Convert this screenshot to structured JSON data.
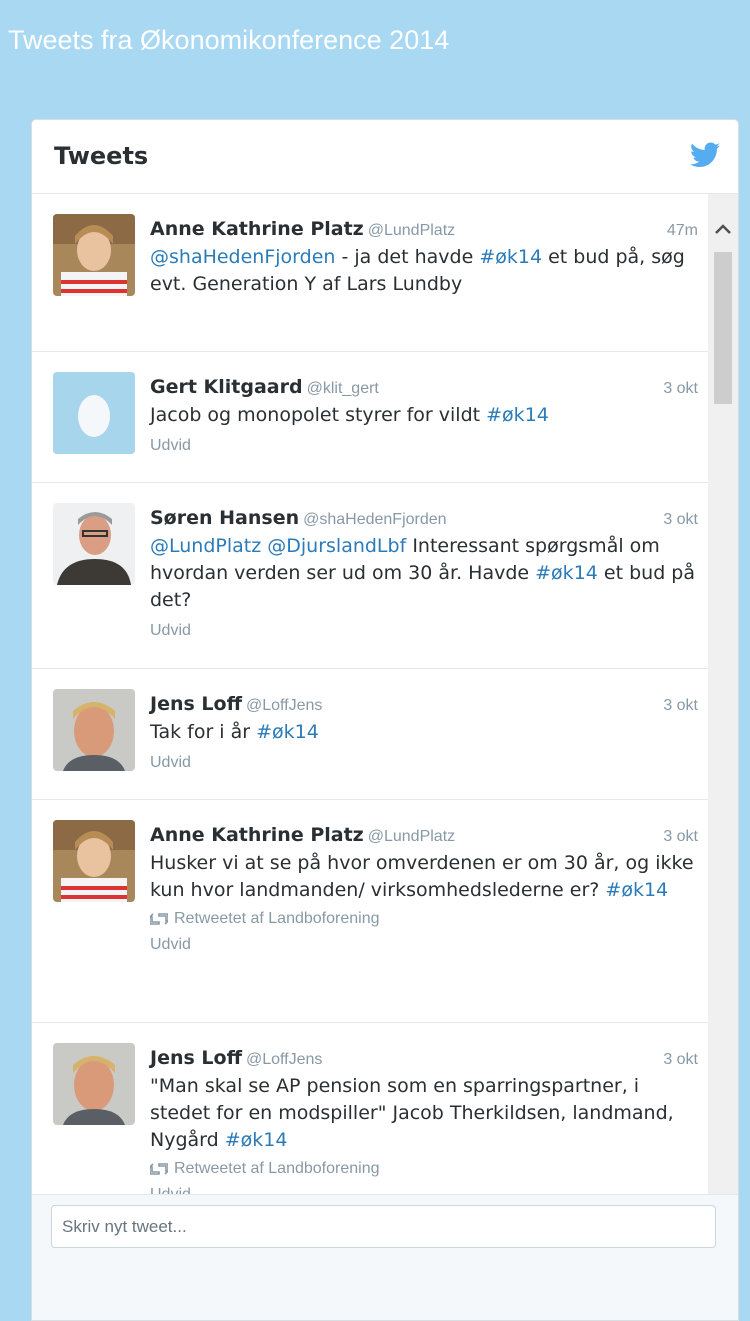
{
  "page": {
    "title": "Tweets fra Økonomikonference 2014"
  },
  "widget": {
    "title": "Tweets",
    "bird_icon": "twitter-bird-icon",
    "bird_color": "#55acee"
  },
  "tweets": [
    {
      "name": "Anne Kathrine Platz",
      "handle": "@LundPlatz",
      "time": "47m",
      "segments": [
        [
          "@shaHedenFjorden",
          true
        ],
        [
          " - ja det havde ",
          false
        ],
        [
          "#øk14",
          true
        ],
        [
          "  et bud på, søg evt. Generation Y af Lars Lundby",
          false
        ]
      ],
      "retweet": "",
      "expand": "",
      "avatar": "woman"
    },
    {
      "name": "Gert Klitgaard",
      "handle": "@klit_gert",
      "time": "3 okt",
      "segments": [
        [
          "Jacob og monopolet styrer for vildt ",
          false
        ],
        [
          "#øk14",
          true
        ]
      ],
      "retweet": "",
      "expand": "Udvid",
      "avatar": "egg"
    },
    {
      "name": "Søren Hansen",
      "handle": "@shaHedenFjorden",
      "time": "3 okt",
      "segments": [
        [
          "@LundPlatz",
          true
        ],
        [
          " ",
          false
        ],
        [
          "@DjurslandLbf",
          true
        ],
        [
          " Interessant spørgsmål om hvordan verden ser ud om 30 år. Havde ",
          false
        ],
        [
          "#øk14",
          true
        ],
        [
          " et bud på det?",
          false
        ]
      ],
      "retweet": "",
      "expand": "Udvid",
      "avatar": "man1"
    },
    {
      "name": "Jens Loff",
      "handle": "@LoffJens",
      "time": "3 okt",
      "segments": [
        [
          "Tak for i år ",
          false
        ],
        [
          "#øk14",
          true
        ]
      ],
      "retweet": "",
      "expand": "Udvid",
      "avatar": "man2"
    },
    {
      "name": "Anne Kathrine Platz",
      "handle": "@LundPlatz",
      "time": "3 okt",
      "segments": [
        [
          "Husker vi at se på hvor omverdenen er om 30 år, og ikke kun hvor landmanden/ virksomhedslederne er? ",
          false
        ],
        [
          "#øk14",
          true
        ]
      ],
      "retweet": "Retweetet af Landboforening",
      "expand": "Udvid",
      "avatar": "woman"
    },
    {
      "name": "Jens Loff",
      "handle": "@LoffJens",
      "time": "3 okt",
      "segments": [
        [
          "\"Man skal se AP pension som en sparringspartner, i stedet for en modspiller\" Jacob Therkildsen, landmand, Nygård ",
          false
        ],
        [
          "#øk14",
          true
        ]
      ],
      "retweet": "Retweetet af Landboforening",
      "expand": "Udvid",
      "avatar": "man2"
    }
  ],
  "compose": {
    "placeholder": "Skriv nyt tweet..."
  },
  "colors": {
    "background": "#a9d8f3",
    "link": "#2b7bb9",
    "muted": "#8899a6",
    "text": "#292f33"
  }
}
